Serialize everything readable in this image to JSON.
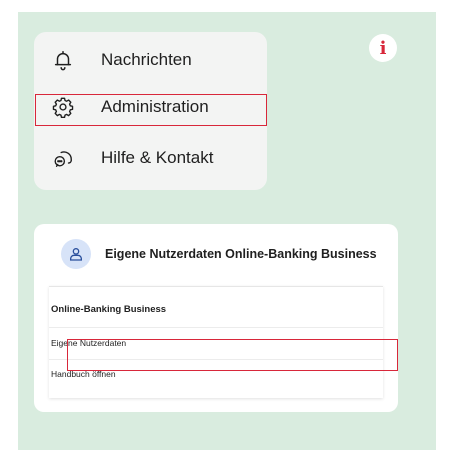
{
  "menu": {
    "items": [
      {
        "label": "Nachrichten",
        "icon": "bell-icon"
      },
      {
        "label": "Administration",
        "icon": "gear-icon"
      },
      {
        "label": "Hilfe & Kontakt",
        "icon": "help-chat-icon"
      }
    ]
  },
  "info_badge": {
    "symbol": "i",
    "color": "#d8273a"
  },
  "card": {
    "title": "Eigene Nutzerdaten Online-Banking Business",
    "avatar_icon": "user-icon",
    "section_header": "Online-Banking Business",
    "items": [
      {
        "label": "Eigene Nutzerdaten"
      },
      {
        "label": "Handbuch öffnen"
      }
    ]
  },
  "colors": {
    "background": "#d9ecdf",
    "highlight": "#d8273a",
    "avatar_bg": "#d7e3f8"
  }
}
